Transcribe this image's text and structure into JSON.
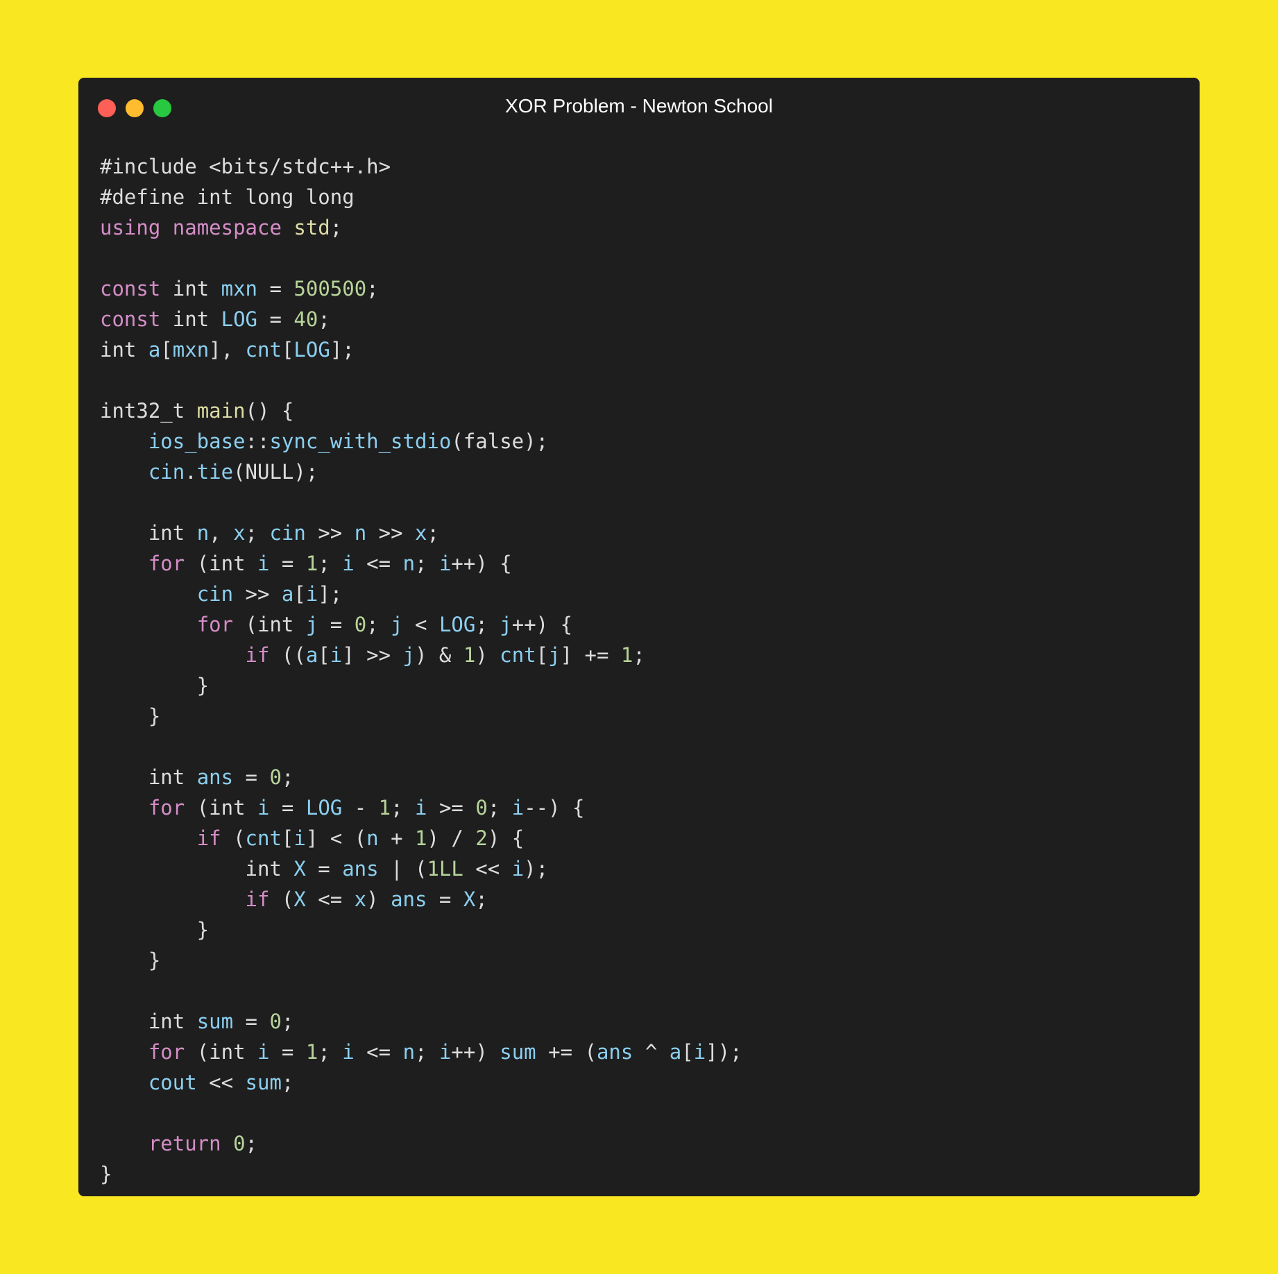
{
  "window": {
    "title": "XOR Problem - Newton School",
    "traffic_lights": [
      {
        "name": "close",
        "color": "#fe5f57"
      },
      {
        "name": "minimize",
        "color": "#febc2e"
      },
      {
        "name": "zoom",
        "color": "#28c840"
      }
    ]
  },
  "colors": {
    "background": "#f9e721",
    "panel": "#1e1e1e",
    "plain": "#dddddd",
    "keyword": "#d48dc7",
    "identifier": "#8ccff0",
    "number": "#b7d49a",
    "function": "#dcdca4"
  },
  "code": {
    "language": "cpp",
    "lines": [
      [
        [
          "pl",
          "#include <bits/stdc++.h>"
        ]
      ],
      [
        [
          "pl",
          "#define int long long"
        ]
      ],
      [
        [
          "kw",
          "using"
        ],
        [
          "pl",
          " "
        ],
        [
          "kw",
          "namespace"
        ],
        [
          "pl",
          " "
        ],
        [
          "fn",
          "std"
        ],
        [
          "pl",
          ";"
        ]
      ],
      [],
      [
        [
          "kw",
          "const"
        ],
        [
          "pl",
          " int "
        ],
        [
          "id",
          "mxn"
        ],
        [
          "pl",
          " = "
        ],
        [
          "num",
          "500500"
        ],
        [
          "pl",
          ";"
        ]
      ],
      [
        [
          "kw",
          "const"
        ],
        [
          "pl",
          " int "
        ],
        [
          "id",
          "LOG"
        ],
        [
          "pl",
          " = "
        ],
        [
          "num",
          "40"
        ],
        [
          "pl",
          ";"
        ]
      ],
      [
        [
          "pl",
          "int "
        ],
        [
          "id",
          "a"
        ],
        [
          "pl",
          "["
        ],
        [
          "id",
          "mxn"
        ],
        [
          "pl",
          "], "
        ],
        [
          "id",
          "cnt"
        ],
        [
          "pl",
          "["
        ],
        [
          "id",
          "LOG"
        ],
        [
          "pl",
          "];"
        ]
      ],
      [],
      [
        [
          "pl",
          "int32_t "
        ],
        [
          "fn",
          "main"
        ],
        [
          "pl",
          "() {"
        ]
      ],
      [
        [
          "pl",
          "    "
        ],
        [
          "id",
          "ios_base"
        ],
        [
          "pl",
          "::"
        ],
        [
          "id",
          "sync_with_stdio"
        ],
        [
          "pl",
          "(false);"
        ]
      ],
      [
        [
          "pl",
          "    "
        ],
        [
          "id",
          "cin"
        ],
        [
          "pl",
          "."
        ],
        [
          "id",
          "tie"
        ],
        [
          "pl",
          "(NULL);"
        ]
      ],
      [],
      [
        [
          "pl",
          "    int "
        ],
        [
          "id",
          "n"
        ],
        [
          "pl",
          ", "
        ],
        [
          "id",
          "x"
        ],
        [
          "pl",
          "; "
        ],
        [
          "id",
          "cin"
        ],
        [
          "pl",
          " >> "
        ],
        [
          "id",
          "n"
        ],
        [
          "pl",
          " >> "
        ],
        [
          "id",
          "x"
        ],
        [
          "pl",
          ";"
        ]
      ],
      [
        [
          "pl",
          "    "
        ],
        [
          "kw",
          "for"
        ],
        [
          "pl",
          " (int "
        ],
        [
          "id",
          "i"
        ],
        [
          "pl",
          " = "
        ],
        [
          "num",
          "1"
        ],
        [
          "pl",
          "; "
        ],
        [
          "id",
          "i"
        ],
        [
          "pl",
          " <= "
        ],
        [
          "id",
          "n"
        ],
        [
          "pl",
          "; "
        ],
        [
          "id",
          "i"
        ],
        [
          "pl",
          "++) {"
        ]
      ],
      [
        [
          "pl",
          "        "
        ],
        [
          "id",
          "cin"
        ],
        [
          "pl",
          " >> "
        ],
        [
          "id",
          "a"
        ],
        [
          "pl",
          "["
        ],
        [
          "id",
          "i"
        ],
        [
          "pl",
          "];"
        ]
      ],
      [
        [
          "pl",
          "        "
        ],
        [
          "kw",
          "for"
        ],
        [
          "pl",
          " (int "
        ],
        [
          "id",
          "j"
        ],
        [
          "pl",
          " = "
        ],
        [
          "num",
          "0"
        ],
        [
          "pl",
          "; "
        ],
        [
          "id",
          "j"
        ],
        [
          "pl",
          " < "
        ],
        [
          "id",
          "LOG"
        ],
        [
          "pl",
          "; "
        ],
        [
          "id",
          "j"
        ],
        [
          "pl",
          "++) {"
        ]
      ],
      [
        [
          "pl",
          "            "
        ],
        [
          "kw",
          "if"
        ],
        [
          "pl",
          " (("
        ],
        [
          "id",
          "a"
        ],
        [
          "pl",
          "["
        ],
        [
          "id",
          "i"
        ],
        [
          "pl",
          "] >> "
        ],
        [
          "id",
          "j"
        ],
        [
          "pl",
          ") & "
        ],
        [
          "num",
          "1"
        ],
        [
          "pl",
          ") "
        ],
        [
          "id",
          "cnt"
        ],
        [
          "pl",
          "["
        ],
        [
          "id",
          "j"
        ],
        [
          "pl",
          "] += "
        ],
        [
          "num",
          "1"
        ],
        [
          "pl",
          ";"
        ]
      ],
      [
        [
          "pl",
          "        }"
        ]
      ],
      [
        [
          "pl",
          "    }"
        ]
      ],
      [],
      [
        [
          "pl",
          "    int "
        ],
        [
          "id",
          "ans"
        ],
        [
          "pl",
          " = "
        ],
        [
          "num",
          "0"
        ],
        [
          "pl",
          ";"
        ]
      ],
      [
        [
          "pl",
          "    "
        ],
        [
          "kw",
          "for"
        ],
        [
          "pl",
          " (int "
        ],
        [
          "id",
          "i"
        ],
        [
          "pl",
          " = "
        ],
        [
          "id",
          "LOG"
        ],
        [
          "pl",
          " - "
        ],
        [
          "num",
          "1"
        ],
        [
          "pl",
          "; "
        ],
        [
          "id",
          "i"
        ],
        [
          "pl",
          " >= "
        ],
        [
          "num",
          "0"
        ],
        [
          "pl",
          "; "
        ],
        [
          "id",
          "i"
        ],
        [
          "pl",
          "--) {"
        ]
      ],
      [
        [
          "pl",
          "        "
        ],
        [
          "kw",
          "if"
        ],
        [
          "pl",
          " ("
        ],
        [
          "id",
          "cnt"
        ],
        [
          "pl",
          "["
        ],
        [
          "id",
          "i"
        ],
        [
          "pl",
          "] < ("
        ],
        [
          "id",
          "n"
        ],
        [
          "pl",
          " + "
        ],
        [
          "num",
          "1"
        ],
        [
          "pl",
          ") / "
        ],
        [
          "num",
          "2"
        ],
        [
          "pl",
          ") {"
        ]
      ],
      [
        [
          "pl",
          "            int "
        ],
        [
          "id",
          "X"
        ],
        [
          "pl",
          " = "
        ],
        [
          "id",
          "ans"
        ],
        [
          "pl",
          " | ("
        ],
        [
          "num",
          "1LL"
        ],
        [
          "pl",
          " << "
        ],
        [
          "id",
          "i"
        ],
        [
          "pl",
          ");"
        ]
      ],
      [
        [
          "pl",
          "            "
        ],
        [
          "kw",
          "if"
        ],
        [
          "pl",
          " ("
        ],
        [
          "id",
          "X"
        ],
        [
          "pl",
          " <= "
        ],
        [
          "id",
          "x"
        ],
        [
          "pl",
          ") "
        ],
        [
          "id",
          "ans"
        ],
        [
          "pl",
          " = "
        ],
        [
          "id",
          "X"
        ],
        [
          "pl",
          ";"
        ]
      ],
      [
        [
          "pl",
          "        }"
        ]
      ],
      [
        [
          "pl",
          "    }"
        ]
      ],
      [],
      [
        [
          "pl",
          "    int "
        ],
        [
          "id",
          "sum"
        ],
        [
          "pl",
          " = "
        ],
        [
          "num",
          "0"
        ],
        [
          "pl",
          ";"
        ]
      ],
      [
        [
          "pl",
          "    "
        ],
        [
          "kw",
          "for"
        ],
        [
          "pl",
          " (int "
        ],
        [
          "id",
          "i"
        ],
        [
          "pl",
          " = "
        ],
        [
          "num",
          "1"
        ],
        [
          "pl",
          "; "
        ],
        [
          "id",
          "i"
        ],
        [
          "pl",
          " <= "
        ],
        [
          "id",
          "n"
        ],
        [
          "pl",
          "; "
        ],
        [
          "id",
          "i"
        ],
        [
          "pl",
          "++) "
        ],
        [
          "id",
          "sum"
        ],
        [
          "pl",
          " += ("
        ],
        [
          "id",
          "ans"
        ],
        [
          "pl",
          " ^ "
        ],
        [
          "id",
          "a"
        ],
        [
          "pl",
          "["
        ],
        [
          "id",
          "i"
        ],
        [
          "pl",
          "]);"
        ]
      ],
      [
        [
          "pl",
          "    "
        ],
        [
          "id",
          "cout"
        ],
        [
          "pl",
          " << "
        ],
        [
          "id",
          "sum"
        ],
        [
          "pl",
          ";"
        ]
      ],
      [],
      [
        [
          "pl",
          "    "
        ],
        [
          "kw",
          "return"
        ],
        [
          "pl",
          " "
        ],
        [
          "num",
          "0"
        ],
        [
          "pl",
          ";"
        ]
      ],
      [
        [
          "pl",
          "}"
        ]
      ]
    ]
  }
}
